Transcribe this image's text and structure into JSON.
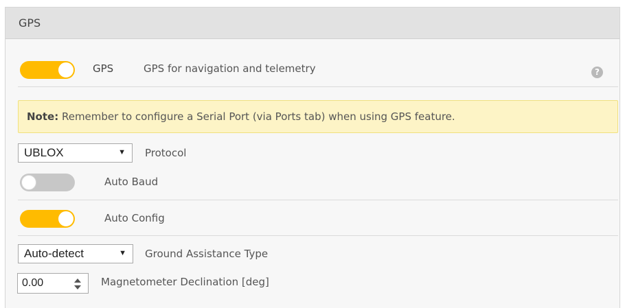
{
  "panel": {
    "title": "GPS"
  },
  "gps_feature": {
    "enabled": true,
    "name": "GPS",
    "description": "GPS for navigation and telemetry",
    "help_glyph": "?"
  },
  "note": {
    "label": "Note:",
    "text": " Remember to configure a Serial Port (via Ports tab) when using GPS feature."
  },
  "protocol": {
    "value": "UBLOX",
    "label": "Protocol"
  },
  "auto_baud": {
    "enabled": false,
    "label": "Auto Baud"
  },
  "auto_config": {
    "enabled": true,
    "label": "Auto Config"
  },
  "ground_assistance": {
    "value": "Auto-detect",
    "label": "Ground Assistance Type"
  },
  "mag_declination": {
    "value": "0.00",
    "label": "Magnetometer Declination [deg]"
  },
  "dropdown_glyph": "▼",
  "colors": {
    "toggle_on": "#ffbb00",
    "toggle_off": "#c7c7c7",
    "note_bg": "#fdf4c6",
    "header_bg": "#e2e2e2"
  },
  "icons": {
    "help": "help-icon",
    "dropdown": "chevron-down-icon"
  }
}
